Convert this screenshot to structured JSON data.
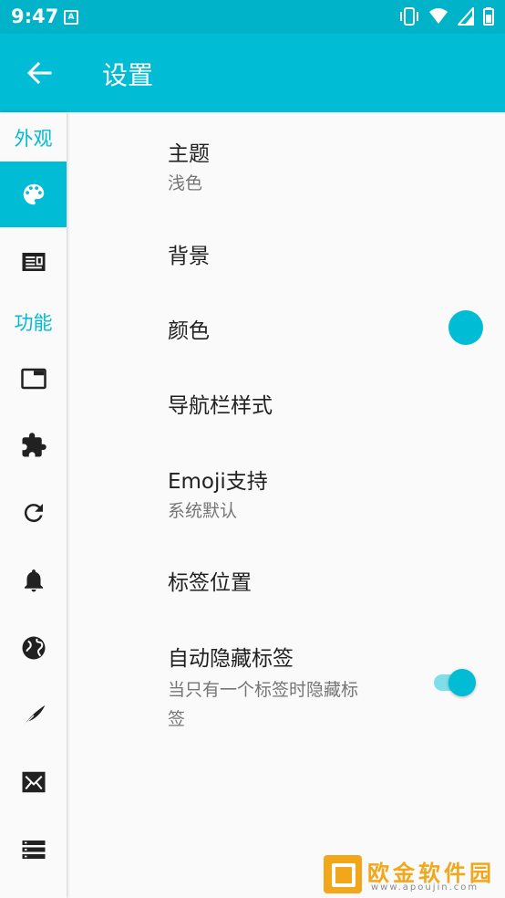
{
  "status_bar": {
    "time": "9:47",
    "notification_icon": "A"
  },
  "app_bar": {
    "title": "设置"
  },
  "sidebar": {
    "sections": [
      {
        "label": "外观"
      },
      {
        "label": "功能"
      }
    ],
    "items": [
      {
        "icon": "palette-icon",
        "active": true
      },
      {
        "icon": "article-icon"
      },
      {
        "icon": "tab-icon"
      },
      {
        "icon": "extension-icon"
      },
      {
        "icon": "refresh-icon"
      },
      {
        "icon": "notification-icon"
      },
      {
        "icon": "globe-icon"
      },
      {
        "icon": "quill-icon"
      },
      {
        "icon": "mail-icon"
      },
      {
        "icon": "storage-icon"
      }
    ]
  },
  "preferences": [
    {
      "title": "主题",
      "summary": "浅色"
    },
    {
      "title": "背景"
    },
    {
      "title": "颜色"
    },
    {
      "title": "导航栏样式"
    },
    {
      "title": "Emoji支持",
      "summary": "系统默认"
    },
    {
      "title": "标签位置"
    },
    {
      "title": "自动隐藏标签",
      "summary_line1": "当只有一个标签时隐藏标",
      "summary_line2": "签",
      "toggle_on": true
    }
  ],
  "colors": {
    "accent": "#00bcd4",
    "status_bar": "#00b3c9",
    "track": "#80deea"
  },
  "watermark": {
    "text": "欧金软件园",
    "url": "www.apoujin.com"
  }
}
